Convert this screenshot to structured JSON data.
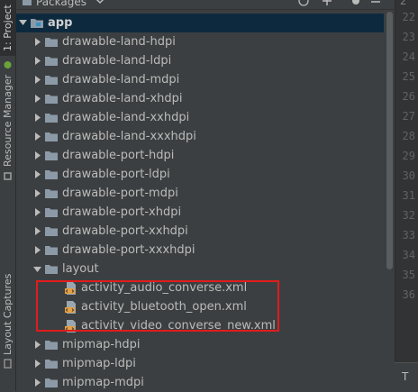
{
  "tool_strip": {
    "project_tab": "1: Project",
    "resource_manager_tab": "Resource Manager",
    "layout_captures_tab": "Layout Captures"
  },
  "header": {
    "view_selector": "Packages"
  },
  "tree": {
    "root": "app",
    "folders_before": [
      "drawable-land-hdpi",
      "drawable-land-ldpi",
      "drawable-land-mdpi",
      "drawable-land-xhdpi",
      "drawable-land-xxhdpi",
      "drawable-land-xxxhdpi",
      "drawable-port-hdpi",
      "drawable-port-ldpi",
      "drawable-port-mdpi",
      "drawable-port-xhdpi",
      "drawable-port-xxhdpi",
      "drawable-port-xxxhdpi"
    ],
    "layout_folder": "layout",
    "layout_files": [
      "activity_audio_converse.xml",
      "activity_bluetooth_open.xml",
      "activity_video_converse_new.xml"
    ],
    "folders_after": [
      "mipmap-hdpi",
      "mipmap-ldpi",
      "mipmap-mdpi"
    ]
  },
  "gutter": {
    "line_numbers": [
      "22",
      "23",
      "24",
      "25",
      "26",
      "27",
      "28",
      "29",
      "30",
      "31",
      "32",
      "33",
      "34",
      "35",
      "36"
    ],
    "top_glyph": "2",
    "bottom_tab": "T"
  },
  "colors": {
    "background": "#3c3f41",
    "selection": "#0d293e",
    "highlight_box": "#e01c1c",
    "folder": "#8c9aa8",
    "xml_icon": "#e8a040"
  }
}
